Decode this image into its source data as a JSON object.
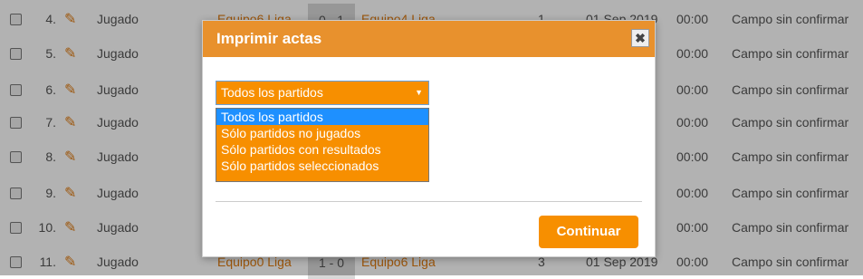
{
  "table": {
    "rows": [
      {
        "num": "4.",
        "state": "Jugado",
        "home": "Equipo6 Liga",
        "score": "0 - 1",
        "away": "Equipo4 Liga",
        "round": "1",
        "date": "01 Sep 2019",
        "time": "00:00",
        "field": "Campo sin confirmar"
      },
      {
        "num": "5.",
        "state": "Jugado",
        "home": "",
        "score": "",
        "away": "",
        "round": "",
        "date": "",
        "time": "00:00",
        "field": "Campo sin confirmar"
      },
      {
        "num": "6.",
        "state": "Jugado",
        "home": "",
        "score": "",
        "away": "",
        "round": "",
        "date": "",
        "time": "00:00",
        "field": "Campo sin confirmar"
      },
      {
        "num": "7.",
        "state": "Jugado",
        "home": "",
        "score": "",
        "away": "",
        "round": "",
        "date": "",
        "time": "00:00",
        "field": "Campo sin confirmar"
      },
      {
        "num": "8.",
        "state": "Jugado",
        "home": "",
        "score": "",
        "away": "",
        "round": "",
        "date": "",
        "time": "00:00",
        "field": "Campo sin confirmar"
      },
      {
        "num": "9.",
        "state": "Jugado",
        "home": "",
        "score": "",
        "away": "",
        "round": "",
        "date": "",
        "time": "00:00",
        "field": "Campo sin confirmar"
      },
      {
        "num": "10.",
        "state": "Jugado",
        "home": "",
        "score": "",
        "away": "",
        "round": "",
        "date": "",
        "time": "00:00",
        "field": "Campo sin confirmar"
      },
      {
        "num": "11.",
        "state": "Jugado",
        "home": "Equipo0 Liga",
        "score": "1 - 0",
        "away": "Equipo6 Liga",
        "round": "3",
        "date": "01 Sep 2019",
        "time": "00:00",
        "field": "Campo sin confirmar"
      }
    ],
    "edit_icon": "pencil-icon"
  },
  "modal": {
    "title": "Imprimir actas",
    "close_label": "✖",
    "select": {
      "value": "Todos los partidos",
      "options": [
        "Todos los partidos",
        "Sólo partidos no jugados",
        "Sólo partidos con resultados",
        "Sólo partidos seleccionados"
      ]
    },
    "continue_label": "Continuar"
  },
  "colors": {
    "accent": "#f78f00",
    "header": "#e8912d",
    "highlight": "#1e90ff",
    "link": "#e07b10"
  }
}
